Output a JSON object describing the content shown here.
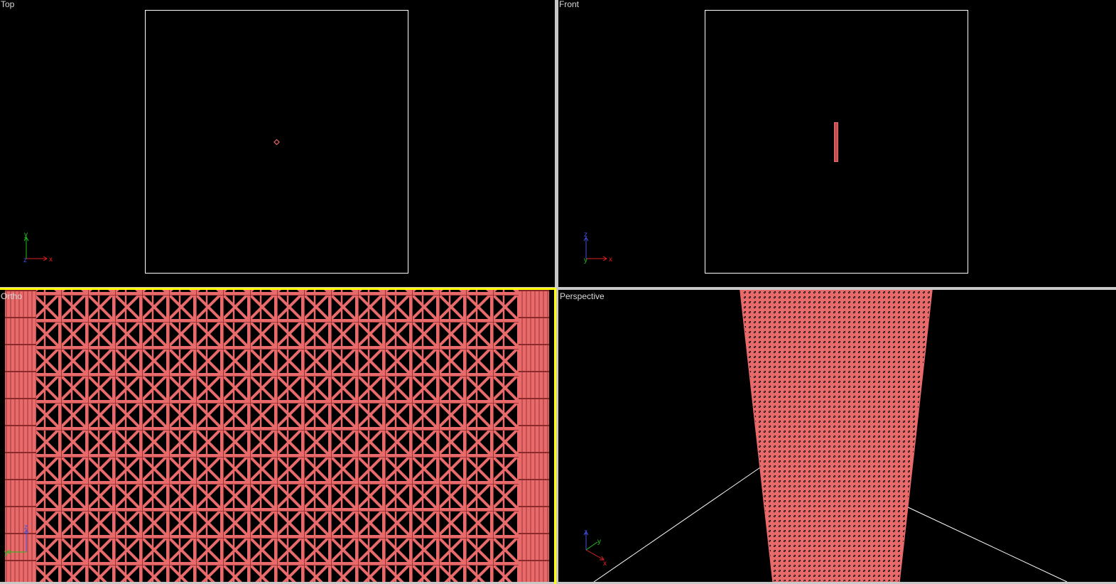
{
  "viewports": {
    "top": {
      "label": "Top",
      "axes": [
        "x",
        "y",
        "z"
      ]
    },
    "front": {
      "label": "Front",
      "axes": [
        "x",
        "z",
        "y"
      ]
    },
    "ortho": {
      "label": "Ortho",
      "axes": [
        "y",
        "z"
      ],
      "active": true
    },
    "perspective": {
      "label": "Perspective",
      "axes": [
        "x",
        "y",
        "z"
      ]
    }
  },
  "colors": {
    "background": "#000000",
    "mesh": "#e86a6a",
    "mesh_dark": "#8a2a2a",
    "frame": "#ffffff",
    "active_border": "#ffff00",
    "axis_x": "#e02020",
    "axis_y": "#20c020",
    "axis_z": "#4050e0"
  },
  "icons": [
    "axis-gizmo-icon"
  ]
}
